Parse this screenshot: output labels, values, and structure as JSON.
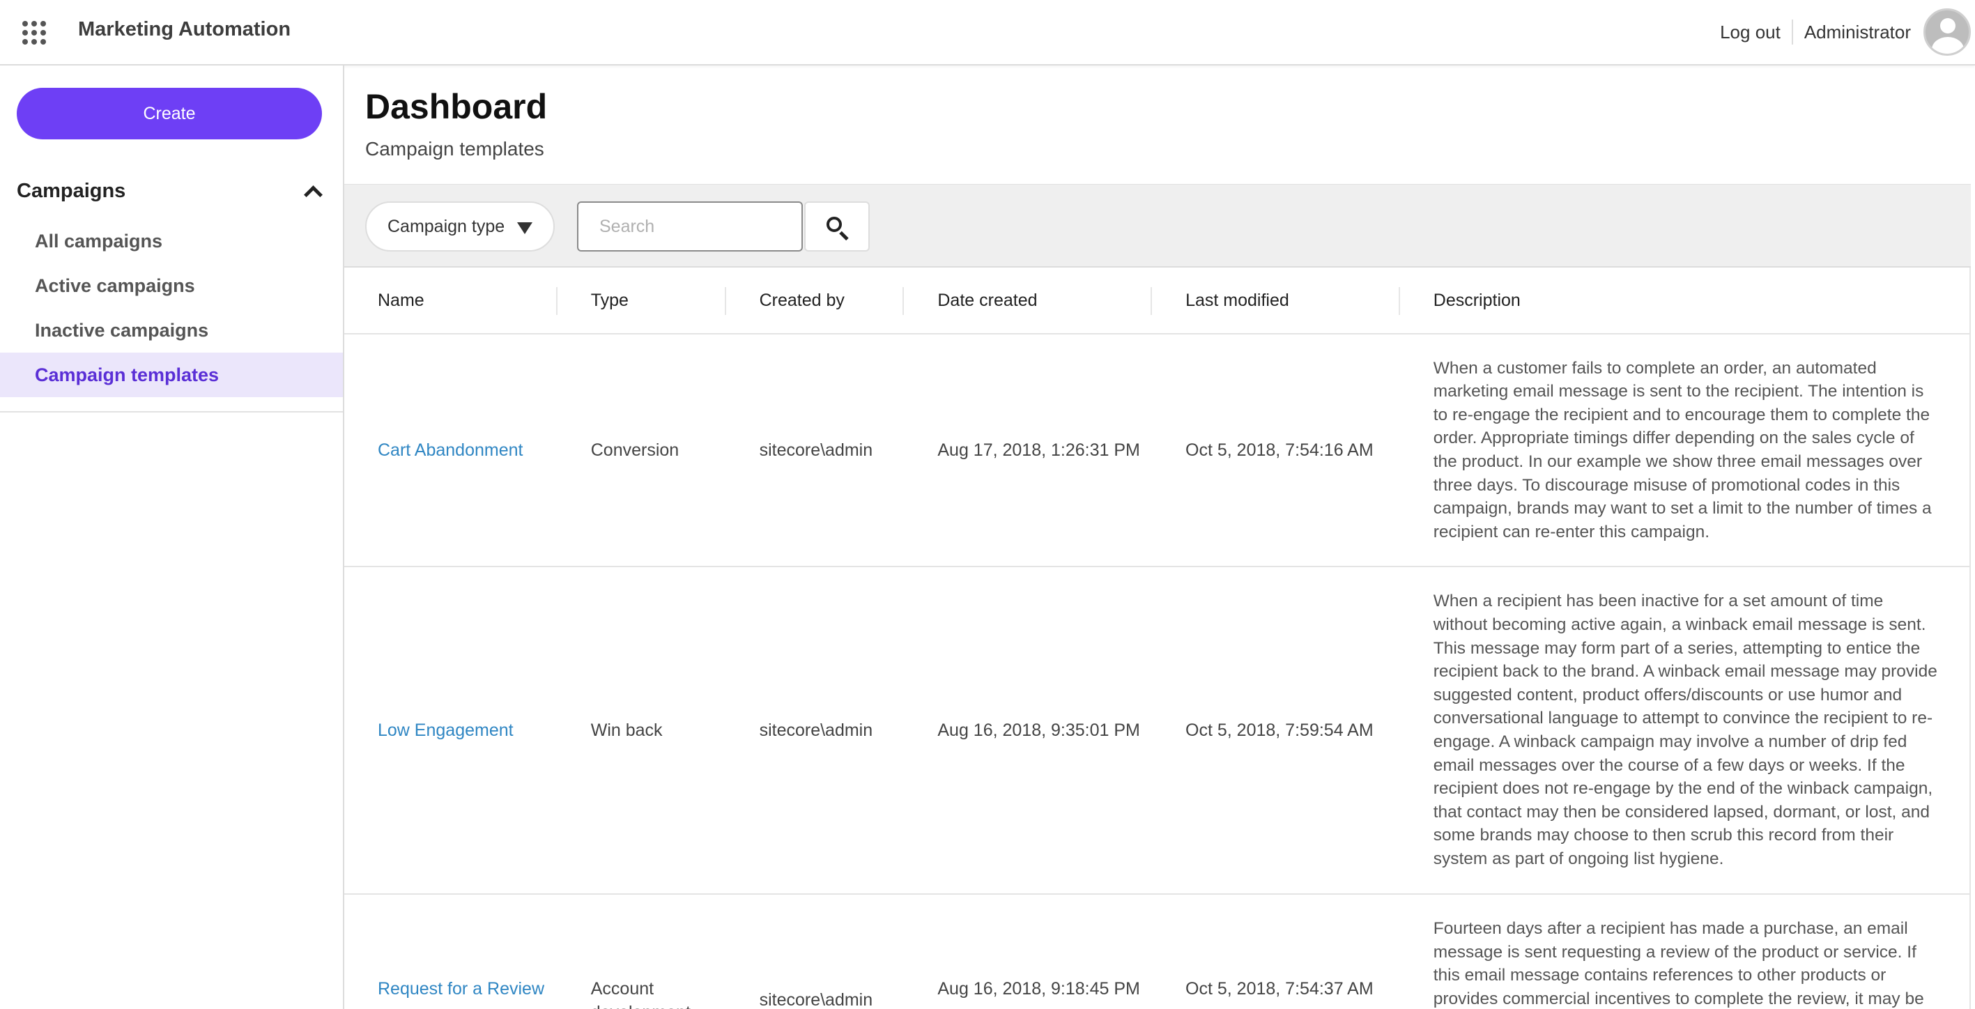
{
  "header": {
    "app_title": "Marketing Automation",
    "logout_label": "Log out",
    "user_name": "Administrator"
  },
  "sidebar": {
    "create_label": "Create",
    "section_title": "Campaigns",
    "items": [
      {
        "label": "All campaigns",
        "active": false
      },
      {
        "label": "Active campaigns",
        "active": false
      },
      {
        "label": "Inactive campaigns",
        "active": false
      },
      {
        "label": "Campaign templates",
        "active": true
      }
    ]
  },
  "main": {
    "title": "Dashboard",
    "subtitle": "Campaign templates"
  },
  "filters": {
    "campaign_type_label": "Campaign type",
    "search_placeholder": "Search"
  },
  "table": {
    "columns": [
      "Name",
      "Type",
      "Created by",
      "Date created",
      "Last modified",
      "Description"
    ],
    "rows": [
      {
        "name": "Cart Abandonment",
        "type": "Conversion",
        "created_by": "sitecore\\admin",
        "date_created": "Aug 17, 2018, 1:26:31 PM",
        "last_modified": "Oct 5, 2018, 7:54:16 AM",
        "description": "When a customer fails to complete an order, an automated marketing email message is sent to the recipient. The intention is to re-engage the recipient and to encourage them to complete the order. Appropriate timings differ depending on the sales cycle of the product. In our example we show three email messages over three days. To discourage misuse of promotional codes in this campaign, brands may want to set a limit to the number of times a recipient can re-enter this campaign."
      },
      {
        "name": "Low Engagement",
        "type": "Win back",
        "created_by": "sitecore\\admin",
        "date_created": "Aug 16, 2018, 9:35:01 PM",
        "last_modified": "Oct 5, 2018, 7:59:54 AM",
        "description": "When a recipient has been inactive for a set amount of time without becoming active again, a winback email message is sent. This message may form part of a series, attempting to entice the recipient back to the brand. A winback email message may provide suggested content, product offers/discounts or use humor and conversational language to attempt to convince the recipient to re-engage. A winback campaign may involve a number of drip fed email messages over the course of a few days or weeks. If the recipient does not re-engage by the end of the winback campaign, that contact may then be considered lapsed, dormant, or lost, and some brands may choose to then scrub this record from their system as part of ongoing list hygiene."
      },
      {
        "name": "Request for a Review",
        "type": "Account development",
        "created_by": "sitecore\\admin",
        "date_created": "Aug 16, 2018, 9:18:45 PM",
        "last_modified": "Oct 5, 2018, 7:54:37 AM",
        "description": "Fourteen days after a recipient has made a purchase, an email message is sent requesting a review of the product or service. If this email message contains references to other products or provides commercial incentives to complete the review, it may be"
      }
    ]
  },
  "colors": {
    "accent": "#6e3ff5",
    "active_nav_bg": "#ebe6fb",
    "active_nav_text": "#5a2fd6",
    "link": "#2f86c3"
  },
  "icons": {
    "app_launcher": "grid-dots-icon",
    "avatar": "user-avatar-icon",
    "collapse": "chevron-up-icon",
    "dropdown": "caret-down-icon",
    "search": "search-icon"
  }
}
